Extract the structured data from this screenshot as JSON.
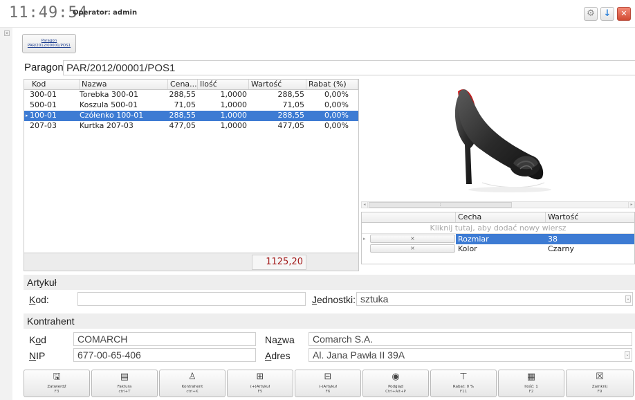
{
  "topbar": {
    "clock": "11:49:54",
    "operator": "Operator: admin",
    "settings_icon": "gear-icon",
    "download_icon": "arrow-down-icon",
    "close_icon": "close-icon"
  },
  "doc_tab": {
    "line1": "Paragon",
    "line2": "PAR/2012/00001/POS1"
  },
  "document": {
    "label": "Paragon",
    "number": "PAR/2012/00001/POS1"
  },
  "items": {
    "headers": {
      "kod": "Kod",
      "nazwa": "Nazwa",
      "cena": "Cena...",
      "ilosc": "Ilość",
      "wartosc": "Wartość",
      "rabat": "Rabat (%)"
    },
    "rows": [
      {
        "kod": "300-01",
        "nazwa": "Torebka 300-01",
        "cena": "288,55",
        "ilosc": "1,0000",
        "wartosc": "288,55",
        "rabat": "0,00%"
      },
      {
        "kod": "500-01",
        "nazwa": "Koszula 500-01",
        "cena": "71,05",
        "ilosc": "1,0000",
        "wartosc": "71,05",
        "rabat": "0,00%"
      },
      {
        "kod": "100-01",
        "nazwa": "Czółenko 100-01",
        "cena": "288,55",
        "ilosc": "1,0000",
        "wartosc": "288,55",
        "rabat": "0,00%"
      },
      {
        "kod": "207-03",
        "nazwa": "Kurtka 207-03",
        "cena": "477,05",
        "ilosc": "1,0000",
        "wartosc": "477,05",
        "rabat": "0,00%"
      }
    ],
    "selected_row": 2,
    "total": "1125,20"
  },
  "attributes": {
    "headers": {
      "cecha": "Cecha",
      "wartosc": "Wartość"
    },
    "add_hint": "Kliknij tutaj, aby dodać nowy wiersz",
    "rows": [
      {
        "delete": "×",
        "cecha": "Rozmiar",
        "wartosc": "38"
      },
      {
        "delete": "×",
        "cecha": "Kolor",
        "wartosc": "Czarny"
      }
    ]
  },
  "artykul": {
    "section": "Artykuł",
    "kod_label_u": "K",
    "kod_label_rest": "od:",
    "kod_value": "",
    "jednostki_label_u": "J",
    "jednostki_label_rest": "ednostki:",
    "jednostki_value": "sztuka"
  },
  "kontrahent": {
    "section": "Kontrahent",
    "kod_label_pre": "K",
    "kod_label_u": "o",
    "kod_label_rest": "d",
    "kod_value": "COMARCH",
    "nip_label_u": "N",
    "nip_label_rest": "IP",
    "nip_value": "677-00-65-406",
    "nazwa_label_pre": "Na",
    "nazwa_label_u": "z",
    "nazwa_label_rest": "wa",
    "nazwa_value": "Comarch S.A.",
    "adres_label_u": "A",
    "adres_label_rest": "dres",
    "adres_value": "Al. Jana Pawła II 39A"
  },
  "toolbar": [
    {
      "icon": "save-icon",
      "glyph": "🖫",
      "label": "Zatwierdź",
      "key": "F3"
    },
    {
      "icon": "invoice-icon",
      "glyph": "▤",
      "label": "Faktura",
      "key": "ctrl+T"
    },
    {
      "icon": "person-icon",
      "glyph": "♙",
      "label": "Kontrahent",
      "key": "ctrl+K"
    },
    {
      "icon": "add-article-icon",
      "glyph": "⊞",
      "label": "(+)Artykuł",
      "key": "F5"
    },
    {
      "icon": "remove-article-icon",
      "glyph": "⊟",
      "label": "(-)Artykuł",
      "key": "F6"
    },
    {
      "icon": "preview-icon",
      "glyph": "◉",
      "label": "Podgląd",
      "key": "Ctrl+Alt+P"
    },
    {
      "icon": "discount-icon",
      "glyph": "⊤",
      "label": "Rabat: 0 %",
      "key": "F11"
    },
    {
      "icon": "quantity-icon",
      "glyph": "▦",
      "label": "Ilość: 1",
      "key": "F2"
    },
    {
      "icon": "close-icon",
      "glyph": "☒",
      "label": "Zamknij",
      "key": "F9"
    }
  ]
}
